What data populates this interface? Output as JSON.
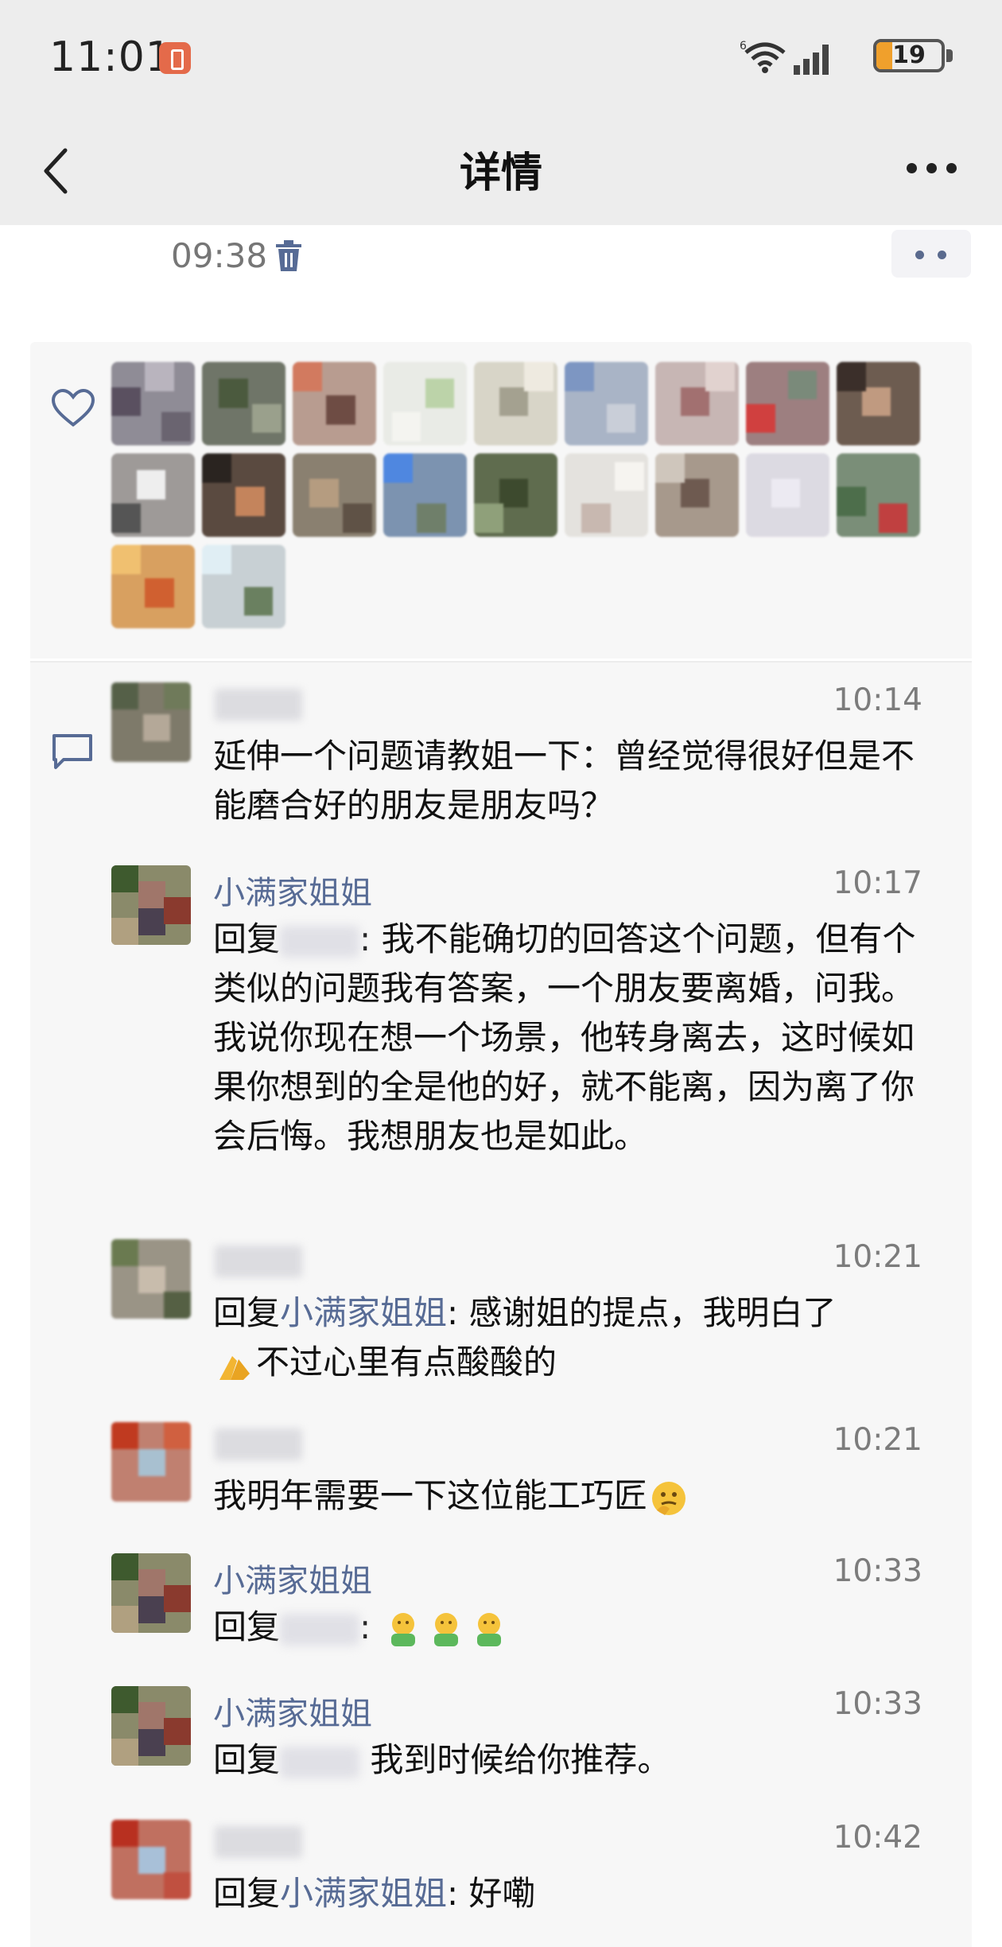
{
  "status": {
    "time": "11:01",
    "network": "6",
    "battery": "19"
  },
  "nav": {
    "title": "详情"
  },
  "post": {
    "time": "09:38"
  },
  "comments": [
    {
      "name": "",
      "time": "10:14",
      "text": "延伸一个问题请教姐一下：曾经觉得很好但是不能磨合好的朋友是朋友吗？"
    },
    {
      "name": "小满家姐姐",
      "time": "10:17",
      "reply_prefix": "回复",
      "text": ": 我不能确切的回答这个问题，但有个类似的问题我有答案，一个朋友要离婚，问我。我说你现在想一个场景，他转身离去，这时候如果你想到的全是他的好，就不能离，因为离了你会后悔。我想朋友也是如此。"
    },
    {
      "name": "",
      "time": "10:21",
      "reply_prefix": "回复",
      "mention": "小满家姐姐",
      "text": ": 感谢姐的提点，我明白了",
      "text2": "不过心里有点酸酸的"
    },
    {
      "name": "",
      "time": "10:21",
      "text": "我明年需要一下这位能工巧匠"
    },
    {
      "name": "小满家姐姐",
      "time": "10:33",
      "reply_prefix": "回复",
      "text": ":"
    },
    {
      "name": "小满家姐姐",
      "time": "10:33",
      "reply_prefix": "回复",
      "text": "我到时候给你推荐。"
    },
    {
      "name": "",
      "time": "10:42",
      "reply_prefix": "回复",
      "mention": "小满家姐姐",
      "text": ": 好嘞"
    }
  ]
}
